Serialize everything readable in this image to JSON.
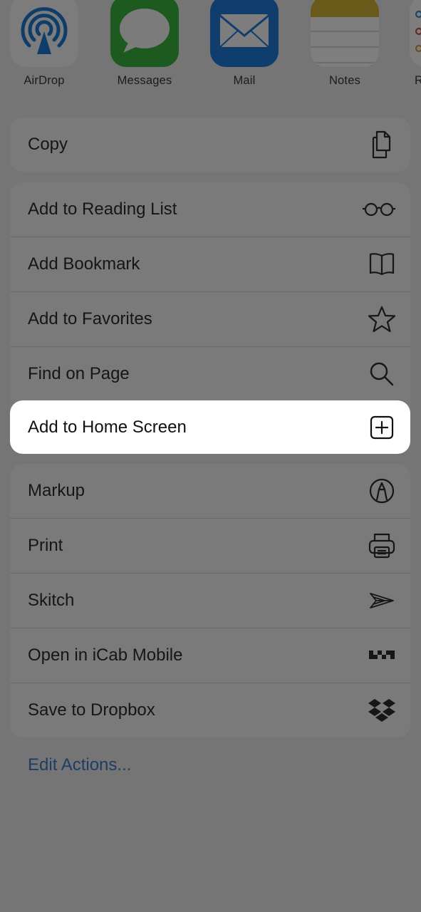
{
  "apps": [
    {
      "label": "AirDrop",
      "icon": "airdrop-icon"
    },
    {
      "label": "Messages",
      "icon": "messages-icon"
    },
    {
      "label": "Mail",
      "icon": "mail-icon"
    },
    {
      "label": "Notes",
      "icon": "notes-icon"
    },
    {
      "label": "R",
      "icon": "reminders-icon"
    }
  ],
  "group1": [
    {
      "label": "Copy",
      "icon": "copy-icon"
    }
  ],
  "group2": [
    {
      "label": "Add to Reading List",
      "icon": "glasses-icon"
    },
    {
      "label": "Add Bookmark",
      "icon": "book-icon"
    },
    {
      "label": "Add to Favorites",
      "icon": "star-icon"
    },
    {
      "label": "Find on Page",
      "icon": "search-icon"
    }
  ],
  "highlighted": {
    "label": "Add to Home Screen",
    "icon": "plus-square-icon"
  },
  "group3": [
    {
      "label": "Markup",
      "icon": "markup-icon"
    },
    {
      "label": "Print",
      "icon": "printer-icon"
    },
    {
      "label": "Skitch",
      "icon": "skitch-icon"
    },
    {
      "label": "Open in iCab Mobile",
      "icon": "icab-icon"
    },
    {
      "label": "Save to Dropbox",
      "icon": "dropbox-icon"
    }
  ],
  "edit_actions": "Edit Actions...",
  "colors": {
    "dim_background": "#757575",
    "group_background": "#7a7a7a",
    "highlight": "#ffffff",
    "link": "#1e3d66"
  }
}
